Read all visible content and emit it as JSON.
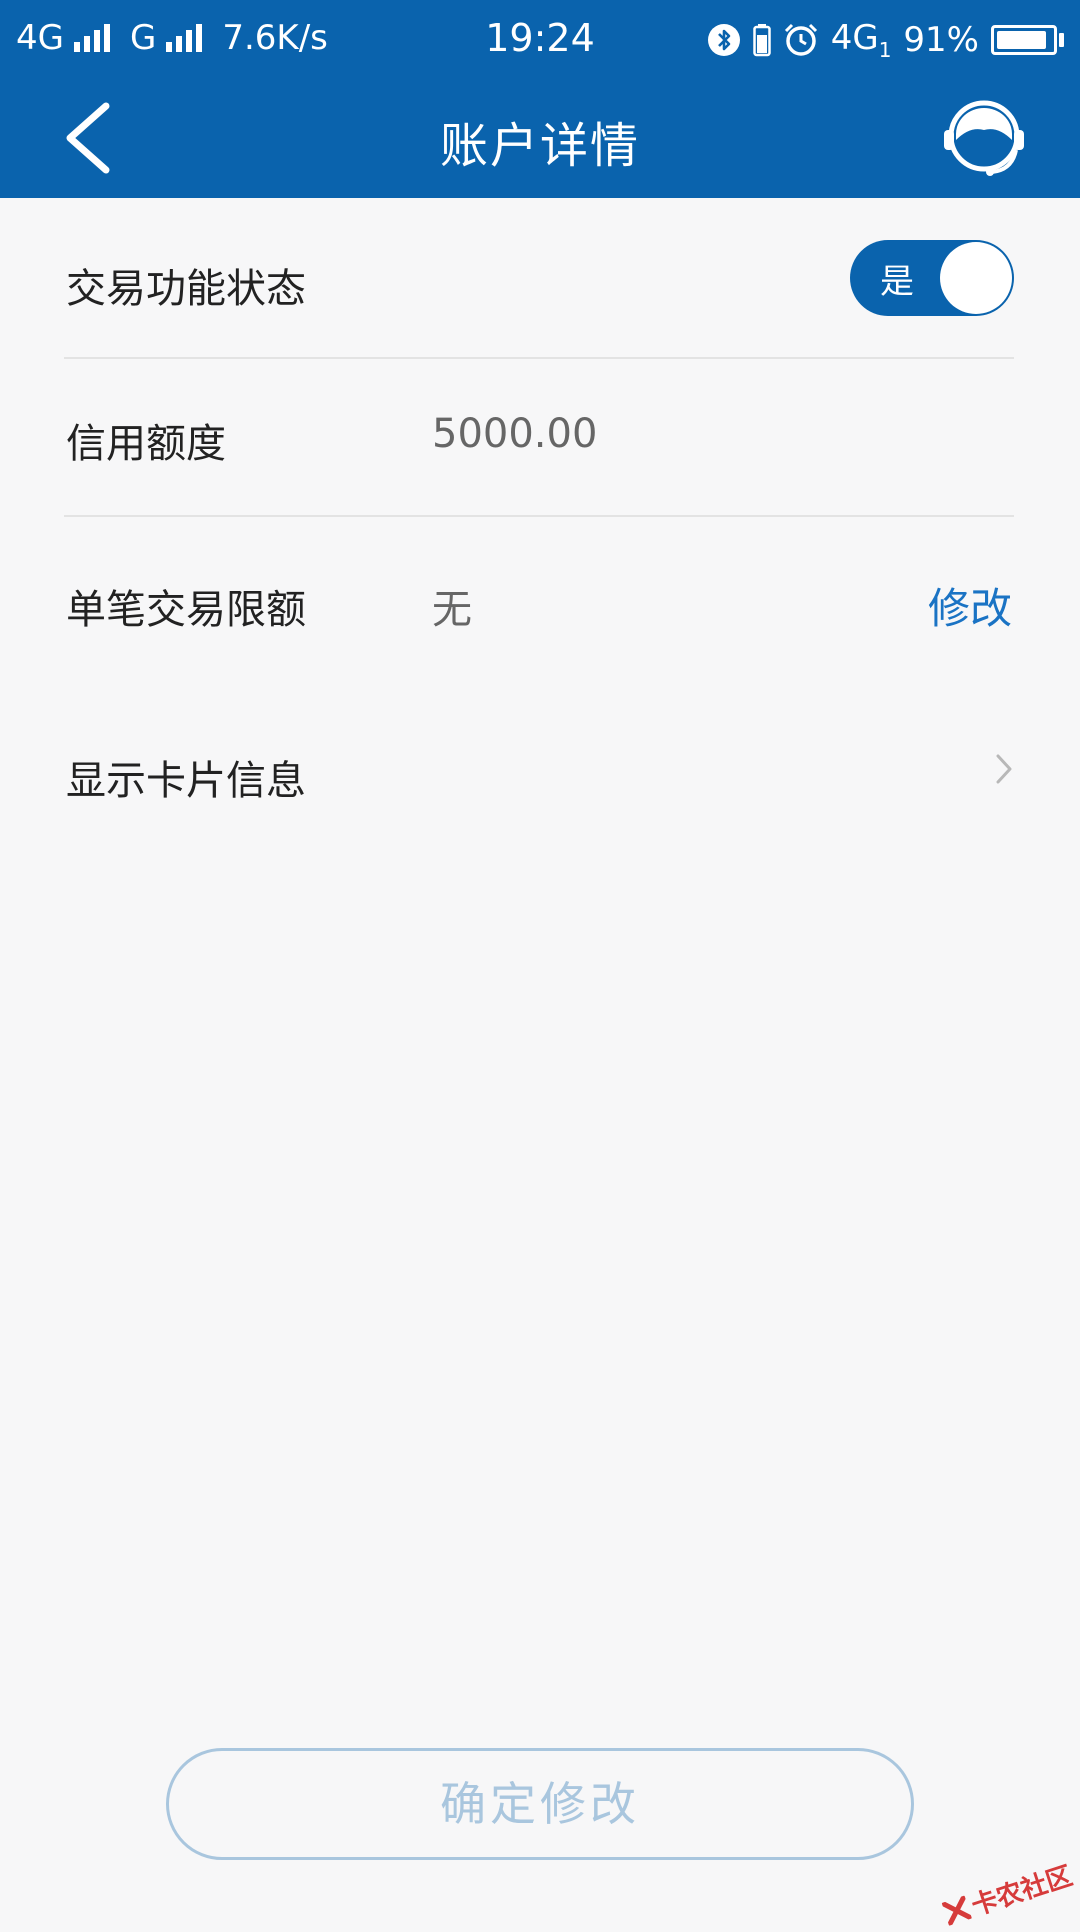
{
  "status_bar": {
    "network1": "4G",
    "network2": "G",
    "speed": "7.6K/s",
    "time": "19:24",
    "network3": "4G",
    "network3_sub": "1",
    "battery_percent_text": "91%",
    "battery_level": 0.91,
    "icons": [
      "bluetooth-icon",
      "battery-small-icon",
      "alarm-icon",
      "charging-battery-icon"
    ]
  },
  "nav": {
    "title": "账户详情",
    "back_icon": "chevron-left-icon",
    "service_icon": "customer-service-icon"
  },
  "rows": {
    "trade_status": {
      "label": "交易功能状态",
      "toggle_text": "是",
      "toggle_on": true
    },
    "credit_limit": {
      "label": "信用额度",
      "value": "5000.00"
    },
    "single_limit": {
      "label": "单笔交易限额",
      "value": "无",
      "action": "修改"
    },
    "card_info": {
      "label": "显示卡片信息"
    }
  },
  "confirm_button": {
    "label": "确定修改"
  },
  "colors": {
    "primary": "#0a63ad",
    "link": "#1a73c4",
    "disabled": "#a9c6de",
    "background": "#f7f7f8"
  },
  "watermark": {
    "text": "卡农社区"
  }
}
